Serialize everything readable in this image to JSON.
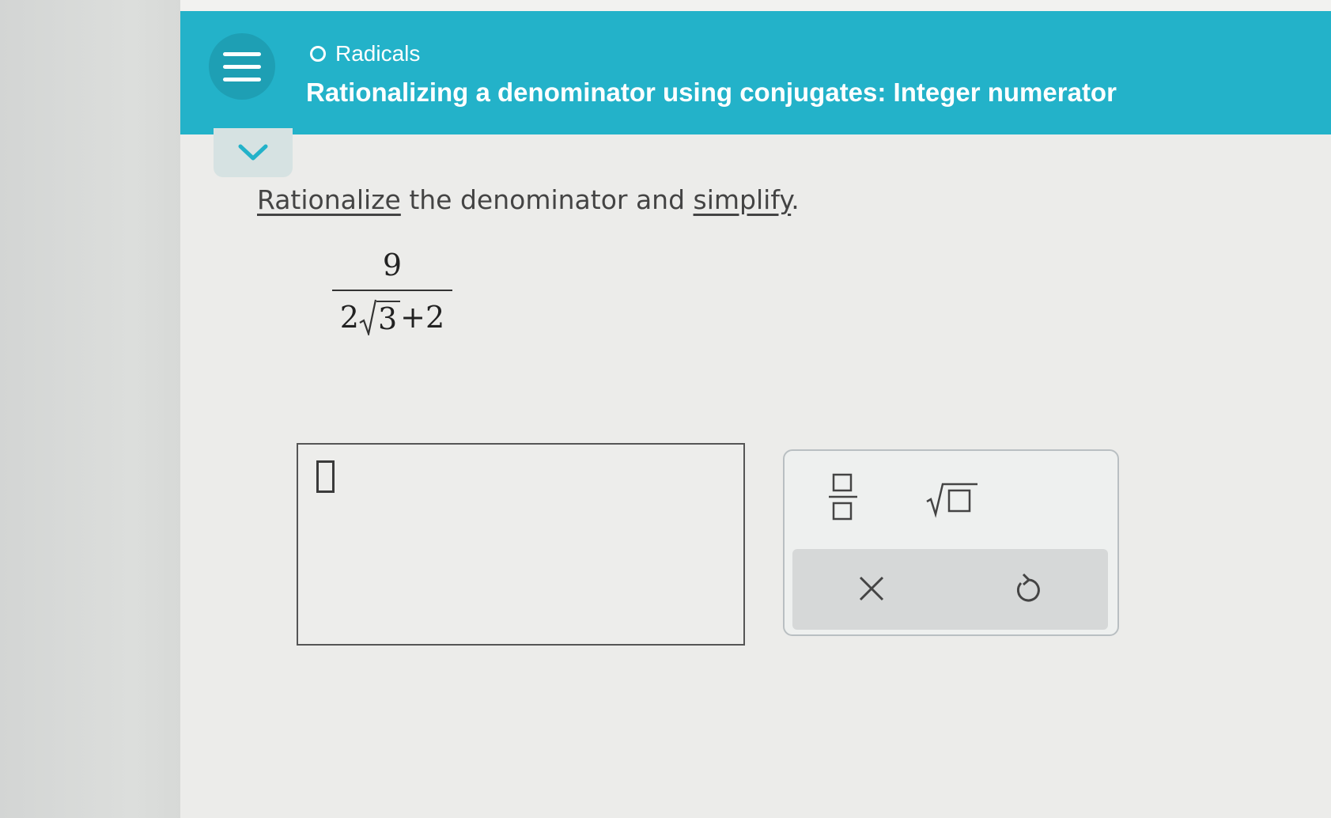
{
  "header": {
    "topic": "Radicals",
    "title": "Rationalizing a denominator using conjugates: Integer numerator",
    "menu_icon": "hamburger-menu-icon",
    "collapse_icon": "chevron-down-icon"
  },
  "problem": {
    "instruction_link1": "Rationalize",
    "instruction_middle": " the denominator and ",
    "instruction_link2": "simplify",
    "instruction_end": ".",
    "numerator": "9",
    "denominator_coefficient": "2",
    "radicand": "3",
    "denominator_tail": "+2"
  },
  "toolbox": {
    "fraction_icon": "fraction-template-icon",
    "sqrt_icon": "square-root-template-icon",
    "clear_icon": "clear-x-icon",
    "undo_icon": "undo-icon"
  },
  "colors": {
    "header": "#23b2c9",
    "menu_button": "#1e9fb4",
    "collapse_tab": "#d6e2e2",
    "chevron": "#23b2c9",
    "tool_bar": "#d6d8d8"
  }
}
